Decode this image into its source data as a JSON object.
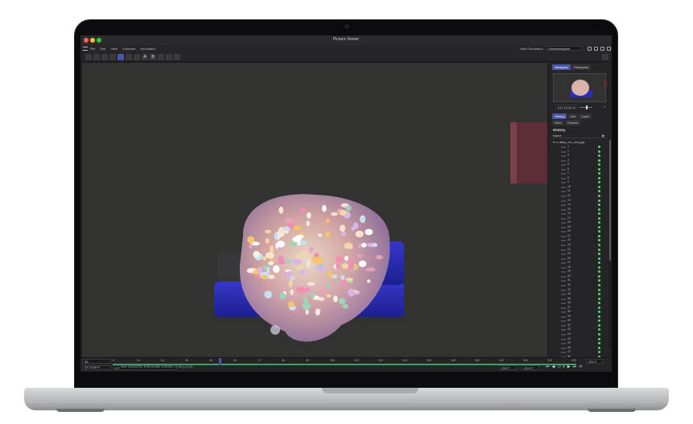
{
  "window": {
    "title": "Picture Viewer"
  },
  "menubar": {
    "items": [
      "File",
      "Edit",
      "View",
      "Compare",
      "Annotation"
    ],
    "view_transform_label": "View Transform:",
    "view_transform_value": "Untonemapped"
  },
  "toolbar": {
    "buttons": [
      {
        "name": "open-folder-icon"
      },
      {
        "name": "save-icon"
      },
      {
        "name": "crop-icon"
      },
      {
        "name": "zoom-fit-icon"
      },
      {
        "name": "zoom-actual-icon",
        "active": true
      },
      {
        "name": "contrast-icon"
      },
      {
        "name": "channel-split-icon"
      },
      {
        "name": "compare-a-icon",
        "label": "A"
      },
      {
        "name": "compare-b-icon",
        "label": "B"
      },
      {
        "name": "compare-swap-icon"
      },
      {
        "name": "undo-icon"
      },
      {
        "name": "redo-icon"
      }
    ]
  },
  "panel": {
    "top_tabs": [
      {
        "label": "Navigator",
        "active": true
      },
      {
        "label": "Histogram"
      }
    ],
    "zoom_value": "237.6128 %",
    "zoom_plus": "+",
    "tabs": [
      {
        "label": "History",
        "active": true
      },
      {
        "label": "Info"
      },
      {
        "label": "Layer"
      },
      {
        "label": "Filter"
      },
      {
        "label": "Frames"
      }
    ],
    "section_title": "History",
    "column_name": "Name",
    "folder_label": "alloy_exr_seq.jpg",
    "history": [
      "1",
      "2",
      "3",
      "4",
      "5",
      "6",
      "7",
      "8",
      "9",
      "10",
      "11",
      "12",
      "13",
      "14",
      "15",
      "16",
      "17",
      "18",
      "19",
      "20",
      "21",
      "22",
      "23",
      "24",
      "25",
      "26",
      "27",
      "28",
      "29",
      "30",
      "31",
      "32",
      "33",
      "34",
      "35",
      "36",
      "37",
      "38",
      "39",
      "40",
      "41",
      "42",
      "43",
      "44",
      "45",
      "46",
      "47",
      "48",
      "49",
      "50"
    ]
  },
  "timeline": {
    "frame_field": "30",
    "start_field": "0 F",
    "zoom_field": "237.6128 %",
    "in_marker": "0 F",
    "end_field": "232 F",
    "fps_field": "23.9 F",
    "total_field": "232 F",
    "ticks": [
      "0",
      "12",
      "24",
      "36",
      "48",
      "60",
      "72",
      "84",
      "96",
      "108",
      "120",
      "132",
      "144",
      "156",
      "168",
      "180",
      "192",
      "204",
      "216",
      "228"
    ],
    "status": "Size: 5120x2700, RGB 16 Bits, 3.95 MB, 1:7.53 (×2.3:3)"
  },
  "colors": {
    "accent": "#4b56a7",
    "progress": "#3e9e66",
    "history_dot": "#5fd36b"
  }
}
